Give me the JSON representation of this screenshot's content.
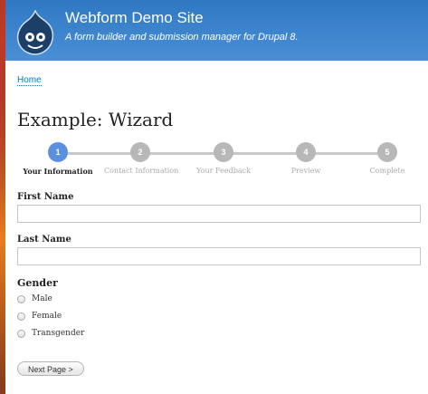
{
  "site": {
    "name": "Webform Demo Site",
    "slogan": "A form builder and submission manager for Drupal 8."
  },
  "breadcrumb": {
    "home": "Home"
  },
  "page": {
    "title": "Example: Wizard"
  },
  "wizard": {
    "steps": [
      {
        "number": "1",
        "label": "Your Information",
        "active": true
      },
      {
        "number": "2",
        "label": "Contact Information",
        "active": false
      },
      {
        "number": "3",
        "label": "Your Feedback",
        "active": false
      },
      {
        "number": "4",
        "label": "Preview",
        "active": false
      },
      {
        "number": "5",
        "label": "Complete",
        "active": false
      }
    ],
    "active_color": "#5b8fe0",
    "inactive_color": "#b8b8b8"
  },
  "form": {
    "first_name": {
      "label": "First Name",
      "value": ""
    },
    "last_name": {
      "label": "Last Name",
      "value": ""
    },
    "gender": {
      "label": "Gender",
      "options": [
        "Male",
        "Female",
        "Transgender"
      ]
    },
    "next_button": "Next Page >"
  },
  "colors": {
    "header": "#3f86cf",
    "link": "#0678be"
  }
}
